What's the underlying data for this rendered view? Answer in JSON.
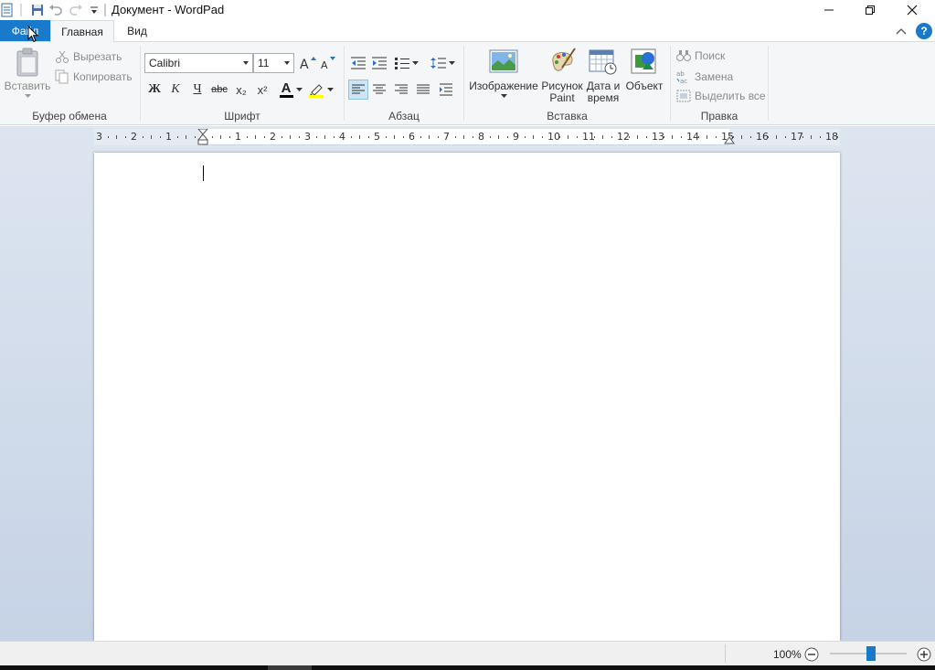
{
  "window": {
    "title": "Документ - WordPad"
  },
  "tabs": {
    "file": "Файл",
    "home": "Главная",
    "view": "Вид"
  },
  "clipboard": {
    "paste": "Вставить",
    "cut": "Вырезать",
    "copy": "Копировать",
    "group_label": "Буфер обмена"
  },
  "font": {
    "family": "Calibri",
    "size": "11",
    "bold": "Ж",
    "italic": "К",
    "underline": "Ч",
    "strike": "abc",
    "subscript": "x₂",
    "superscript": "x²",
    "color_letter": "A",
    "group_label": "Шрифт",
    "text_color": "#000000",
    "highlight_color": "#ffff00"
  },
  "paragraph": {
    "group_label": "Абзац",
    "selected_alignment": "left"
  },
  "insert": {
    "picture": "Изображение",
    "paint_line1": "Рисунок",
    "paint_line2": "Paint",
    "datetime_line1": "Дата и",
    "datetime_line2": "время",
    "object": "Объект",
    "group_label": "Вставка"
  },
  "editing": {
    "find": "Поиск",
    "replace": "Замена",
    "select_all": "Выделить все",
    "group_label": "Правка"
  },
  "ruler": {
    "labels": [
      "3",
      "2",
      "1",
      "",
      "1",
      "2",
      "3",
      "4",
      "5",
      "6",
      "7",
      "8",
      "9",
      "10",
      "11",
      "12",
      "13",
      "14",
      "15",
      "16",
      "17",
      "18"
    ]
  },
  "status": {
    "zoom": "100%",
    "zoom_fraction": 0.5
  },
  "colors": {
    "accent": "#1979ca",
    "ribbon_bg": "#f5f6f7",
    "workspace_bg": "#c6d3e6"
  }
}
